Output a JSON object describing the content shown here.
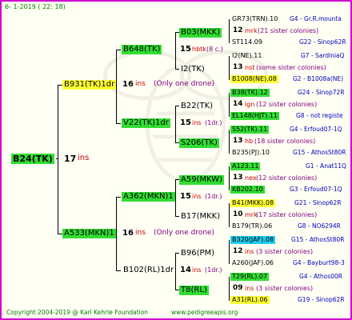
{
  "header": {
    "date_text": "6-  1-2019 ( 22: 18)"
  },
  "root": {
    "name": "B24(TK)",
    "num": "17",
    "suffix": "ins"
  },
  "gen2": [
    {
      "name": "B931(TK)1dr",
      "num": "16",
      "suffix": "ins",
      "note": "(Only one drone)"
    },
    {
      "name": "A533(MKN)1",
      "num": "16",
      "suffix": "ins",
      "note": "(Only one drone)"
    }
  ],
  "gen3": [
    {
      "name": "B648(TK)",
      "num": "15",
      "suffix": "hbtk",
      "note": "(8 c.)"
    },
    {
      "name": "V22(TK)1dr",
      "num": "15",
      "suffix": "ins",
      "note": "(1dr.)"
    },
    {
      "name": "A362(MKN)1",
      "num": "15",
      "suffix": "ins",
      "note": "(1dr.)"
    },
    {
      "name": "B102(RL)1dr",
      "num": "14",
      "suffix": "ins",
      "note": "(1dr.)"
    }
  ],
  "gen4": [
    "B03(MKK)",
    "I2(TK)",
    "B22(TK)",
    "S206(TK)",
    "A59(MKW)",
    "B17(MKK)",
    "B96(PM)",
    "T8(RL)"
  ],
  "gen5": [
    {
      "parent": "GR73(TRN).10",
      "tip": "G4 - Gr.R.mounta"
    },
    {
      "num": "12",
      "suffix": "mrk",
      "note": "(21 sister colonies)"
    },
    {
      "parent": "ST114.09",
      "tip": "G22 - Sinop62R"
    },
    {
      "parent": "I2(NE).11",
      "tip": "G7 - SardiniaQ"
    },
    {
      "num": "13",
      "suffix": "nst",
      "note": "(some sister colonies)"
    },
    {
      "parent": "B1008(NE).08",
      "tip": "G2 - B1008a(NE)"
    },
    {
      "parent": "B38(TK).12",
      "tip": "G24 - Sinop72R"
    },
    {
      "num": "14",
      "suffix": "lgn",
      "note": "(12 sister colonies)"
    },
    {
      "parent": "EL148(HJT).11",
      "tip": "G8 - not registe"
    },
    {
      "parent": "S52(TK).11",
      "tip": "G4 - Erfoud07-1Q"
    },
    {
      "num": "13",
      "suffix": "hb",
      "note": "(18 sister colonies)"
    },
    {
      "parent": "B235(PJ).10",
      "tip": "G15 - AthosSt80R"
    },
    {
      "parent": "A123.11",
      "tip": "G1 - Anat11Q"
    },
    {
      "num": "13",
      "suffix": "nex",
      "note": "(12 sister colonies)"
    },
    {
      "parent": "KB202.10",
      "tip": "G3 - Erfoud07-1Q"
    },
    {
      "parent": "B41(MKK).08",
      "tip": "G21 - Sinop62R"
    },
    {
      "num": "10",
      "suffix": "mrk",
      "note": "(17 sister colonies)"
    },
    {
      "parent": "B179(TR).06",
      "tip": "G8 - NO6294R"
    },
    {
      "parent": "B320(JAF).08",
      "tip": "G15 - AthosSt80R"
    },
    {
      "num": "12",
      "suffix": "ins",
      "note": "(3 sister colonies)"
    },
    {
      "parent": "A260(JAF).06",
      "tip": "G4 - Bayburt98-3"
    },
    {
      "parent": "T29(RL).07",
      "tip": "G4 - Athos00R"
    },
    {
      "num": "09",
      "suffix": "ins",
      "note": "(3 sister colonies)"
    },
    {
      "parent": "A31(RL).06",
      "tip": "G19 - Sinop62R"
    }
  ],
  "footer": {
    "copyright": "Copyright 2004-2019 @ Karl Kehrle Foundation",
    "url": "www.pedigreeapis.org"
  },
  "colors": {
    "border": "#d000d0",
    "yellow": "#ffff33",
    "green": "#33dd33",
    "cyan": "#22ccee"
  }
}
